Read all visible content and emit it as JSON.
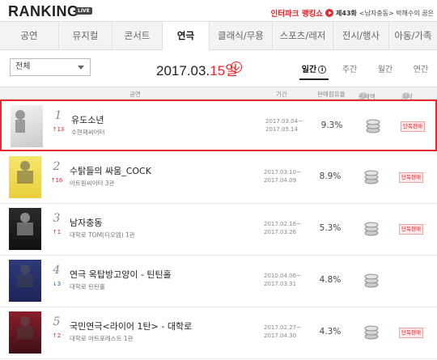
{
  "header": {
    "logo": "RANKING",
    "live_badge": "LIVE",
    "promo": {
      "brand": "인터파크 랭킹쇼",
      "episode": "제43화",
      "text": "<남자충동> 박해수의 꿈은"
    }
  },
  "tabs": [
    "공연",
    "뮤지컬",
    "콘서트",
    "연극",
    "클래식/무용",
    "스포츠/레저",
    "전시/행사",
    "아동/가족"
  ],
  "active_tab": 3,
  "filter": {
    "select_value": "전체",
    "date_prefix": "2017.03.",
    "date_day": "15일",
    "periods": [
      "일간",
      "주간",
      "월간",
      "연간"
    ],
    "active_period": 0
  },
  "table_header": {
    "show": "공연",
    "period": "기간",
    "share": "판매점유율",
    "sales": "판매액",
    "review": "좌석"
  },
  "colors": {
    "accent": "#e6282f",
    "down": "#1f5fbf"
  },
  "rows": [
    {
      "rank": "1",
      "change": "↑13",
      "direction": "up",
      "title": "유도소년",
      "venue": "수현재씨어터",
      "start": "2017.03.04~",
      "end": "2017.05.14",
      "share": "9.3%",
      "badge": "단독판매",
      "poster_text": "유도\n소년"
    },
    {
      "rank": "2",
      "change": "↑16",
      "direction": "up",
      "title": "수탉들의 싸움_COCK",
      "venue": "아트원씨어터 3관",
      "start": "2017.03.10~",
      "end": "2017.04.09",
      "share": "8.9%",
      "badge": "단독판매",
      "poster_text": "COCK"
    },
    {
      "rank": "3",
      "change": "↑1",
      "direction": "up",
      "title": "남자충동",
      "venue": "대학로 TOM(티오엠) 1관",
      "start": "2017.02.16~",
      "end": "2017.03.26",
      "share": "5.3%",
      "badge": "단독판매",
      "poster_text": "남자충동"
    },
    {
      "rank": "4",
      "change": "↓3",
      "direction": "down",
      "title": "연극 옥탑방고양이 - 틴틴홀",
      "venue": "대학로 틴틴홀",
      "start": "2010.04.06~",
      "end": "2017.03.31",
      "share": "4.8%",
      "badge": "",
      "poster_text": "옥탑방\n고양이"
    },
    {
      "rank": "5",
      "change": "↑2",
      "direction": "up",
      "title": "국민연극<라이어 1탄> - 대학로",
      "venue": "대학로 아트포레스트 1관",
      "start": "2017.02.27~",
      "end": "2017.04.30",
      "share": "4.3%",
      "badge": "단독판매",
      "poster_text": "라이어"
    }
  ]
}
